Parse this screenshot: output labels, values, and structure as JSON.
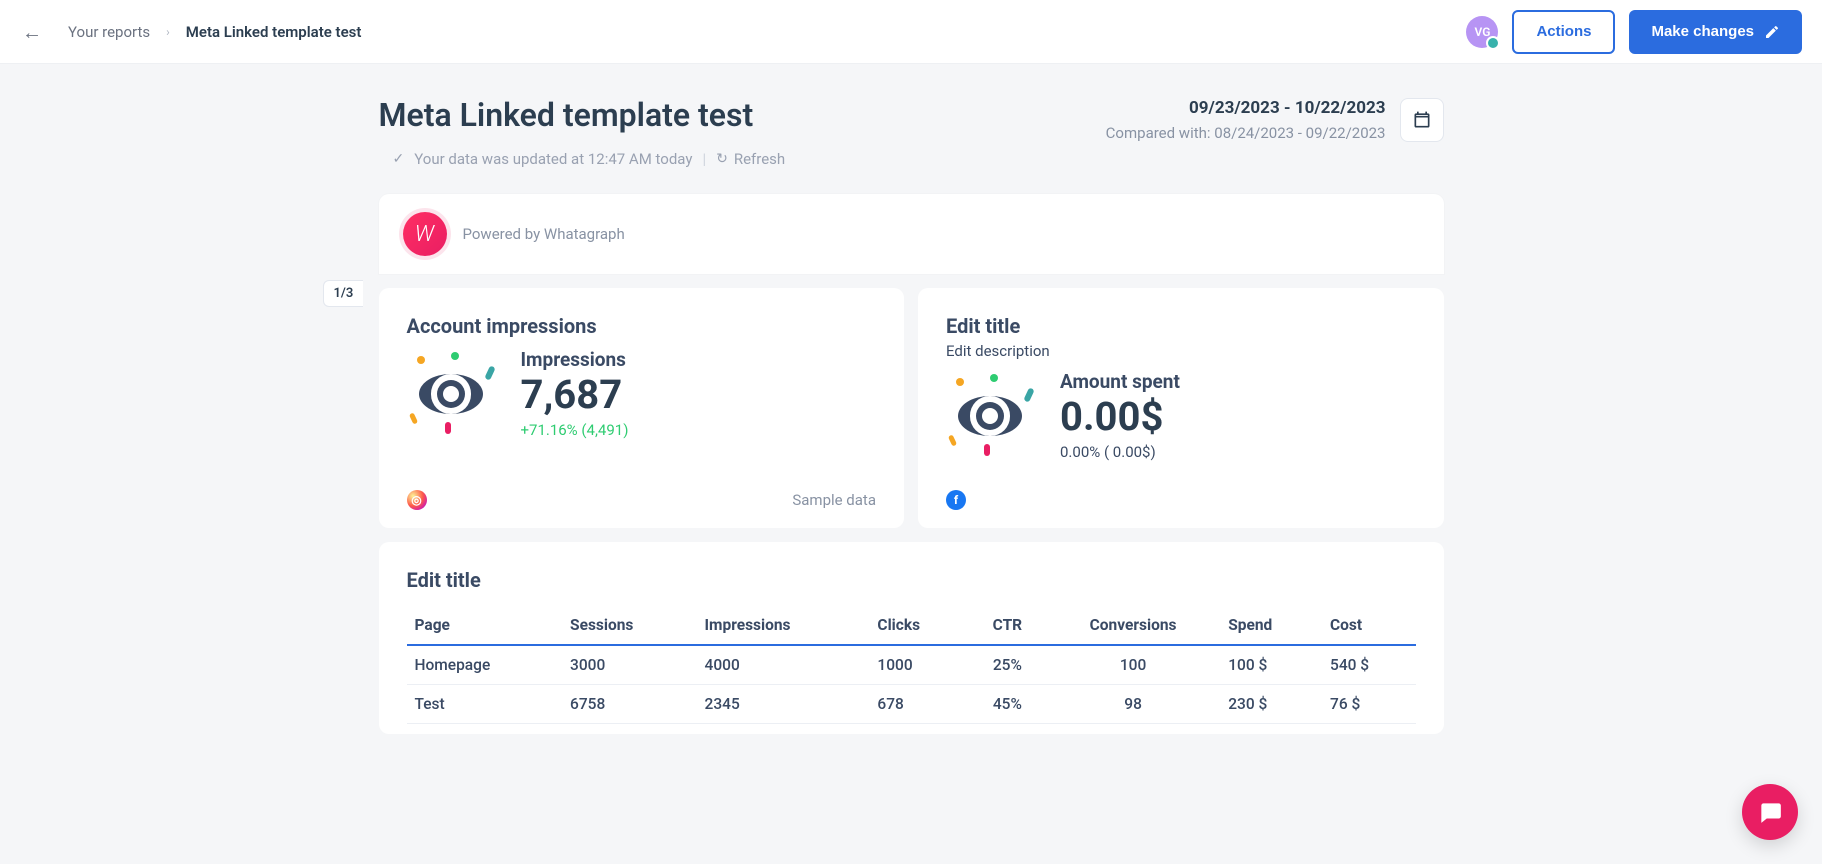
{
  "header": {
    "back_icon": "←",
    "breadcrumbs": {
      "root": "Your reports",
      "current": "Meta Linked template test"
    },
    "avatar_initials": "VG",
    "actions_label": "Actions",
    "make_changes_label": "Make changes"
  },
  "page": {
    "title": "Meta Linked template test",
    "data_status": "Your data was updated at 12:47 AM today",
    "refresh_label": "Refresh",
    "date_range": "09/23/2023 - 10/22/2023",
    "compared_with_label": "Compared with:",
    "compared_range": "08/24/2023 - 09/22/2023",
    "page_indicator": "1/3"
  },
  "branding": {
    "logo_letter": "W",
    "powered_by": "Powered by Whatagraph"
  },
  "widgets": {
    "impressions": {
      "title": "Account impressions",
      "metric_label": "Impressions",
      "metric_value": "7,687",
      "change": "+71.16% (4,491)",
      "footer_text": "Sample data",
      "social": "instagram"
    },
    "amount_spent": {
      "title": "Edit title",
      "description": "Edit description",
      "metric_label": "Amount spent",
      "metric_value": "0.00$",
      "change": "0.00% ( 0.00$)",
      "social": "facebook"
    }
  },
  "table": {
    "title": "Edit title",
    "columns": [
      "Page",
      "Sessions",
      "Impressions",
      "Clicks",
      "CTR",
      "Conversions",
      "Spend",
      "Cost"
    ],
    "rows": [
      {
        "cells": [
          "Homepage",
          "3000",
          "4000",
          "1000",
          "25%",
          "100",
          "100 $",
          "540 $"
        ]
      },
      {
        "cells": [
          "Test",
          "6758",
          "2345",
          "678",
          "45%",
          "98",
          "230 $",
          "76 $"
        ]
      }
    ]
  }
}
